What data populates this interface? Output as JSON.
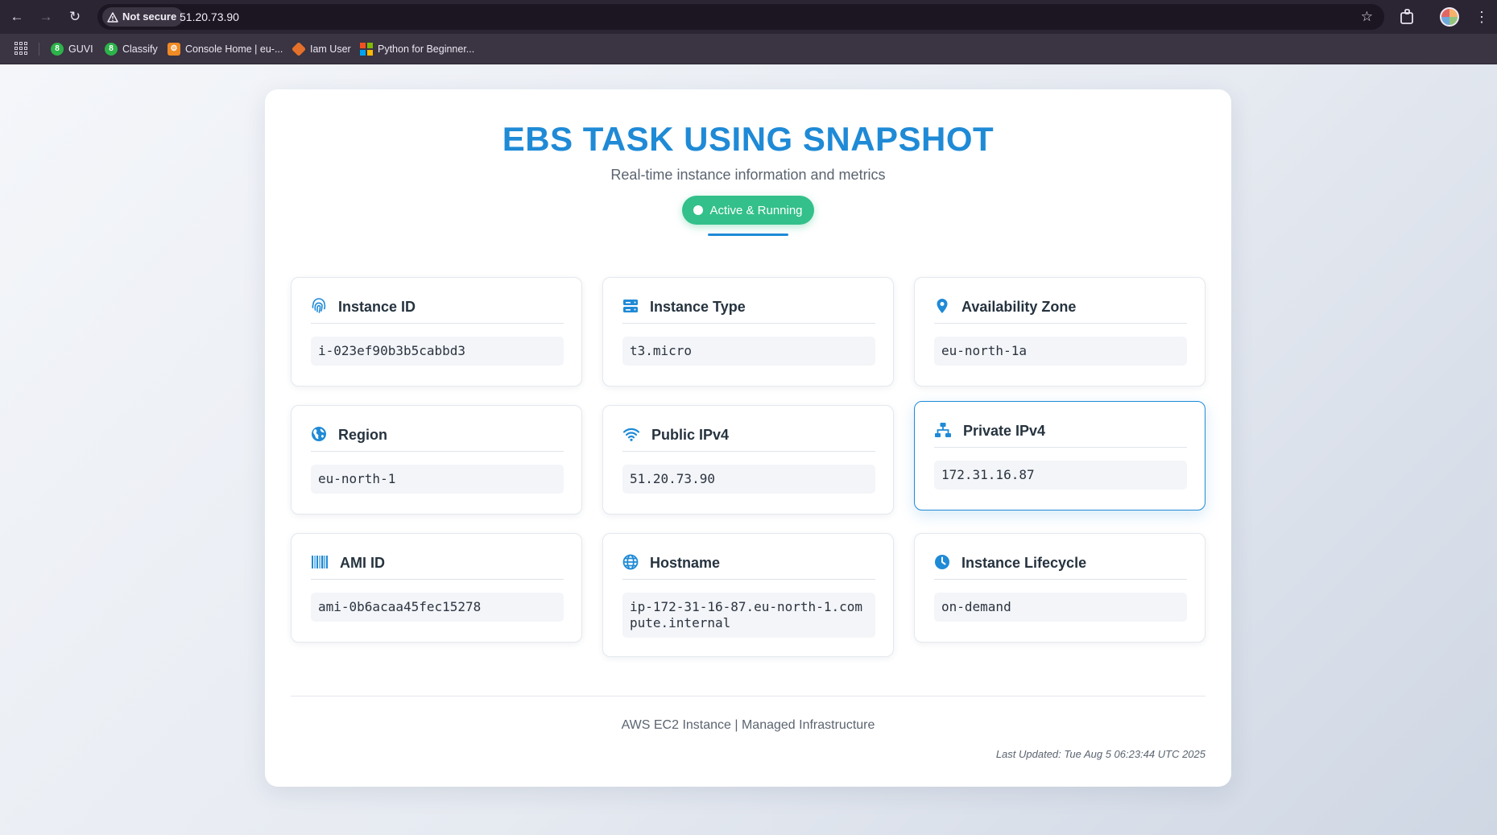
{
  "browser": {
    "security_label": "Not secure",
    "url": "51.20.73.90",
    "bookmarks": [
      {
        "label": "GUVI",
        "icon": "guvi-favicon"
      },
      {
        "label": "Classify",
        "icon": "classify-favicon"
      },
      {
        "label": "Console Home | eu-...",
        "icon": "aws-console-favicon"
      },
      {
        "label": "Iam User",
        "icon": "iam-favicon"
      },
      {
        "label": "Python for Beginner...",
        "icon": "microsoft-favicon"
      }
    ]
  },
  "header": {
    "title": "EBS TASK USING SNAPSHOT",
    "subtitle": "Real-time instance information and metrics",
    "status": "Active & Running"
  },
  "colors": {
    "accent": "#1f8ad6",
    "status": "#33c08a",
    "heading": "#26333f"
  },
  "cards": [
    {
      "label": "Instance ID",
      "value": "i-023ef90b3b5cabbd3",
      "icon": "fingerprint-icon"
    },
    {
      "label": "Instance Type",
      "value": "t3.micro",
      "icon": "server-icon"
    },
    {
      "label": "Availability Zone",
      "value": "eu-north-1a",
      "icon": "map-pin-icon"
    },
    {
      "label": "Region",
      "value": "eu-north-1",
      "icon": "globe-americas-icon"
    },
    {
      "label": "Public IPv4",
      "value": "51.20.73.90",
      "icon": "wifi-icon"
    },
    {
      "label": "Private IPv4",
      "value": "172.31.16.87",
      "icon": "network-icon"
    },
    {
      "label": "AMI ID",
      "value": "ami-0b6acaa45fec15278",
      "icon": "barcode-icon"
    },
    {
      "label": "Hostname",
      "value": "ip-172-31-16-87.eu-north-1.compute.internal",
      "icon": "globe-icon"
    },
    {
      "label": "Instance Lifecycle",
      "value": "on-demand",
      "icon": "clock-icon"
    }
  ],
  "footer": {
    "text": "AWS EC2 Instance | Managed Infrastructure",
    "updated": "Last Updated: Tue Aug 5 06:23:44 UTC 2025"
  }
}
